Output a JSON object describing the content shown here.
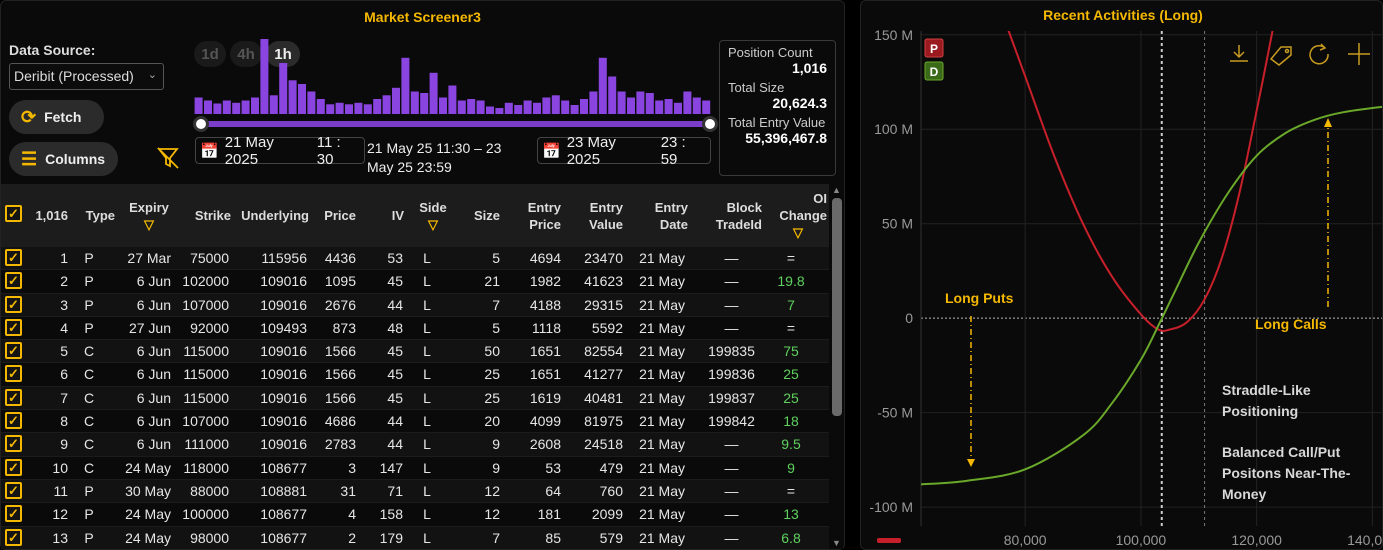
{
  "screener": {
    "title": "Market Screener3",
    "data_source_label": "Data Source:",
    "data_source_value": "Deribit (Processed)",
    "fetch_label": "Fetch",
    "columns_label": "Columns",
    "timeframes": [
      "1d",
      "4h",
      "1h"
    ],
    "active_timeframe": "1h",
    "start_date": "21 May 2025",
    "start_time": "11 : 30",
    "end_date": "23 May 2025",
    "end_time": "23 : 59",
    "range_line1": "21 May 25 11:30 – 23",
    "range_line2": "May 25 23:59",
    "histogram": [
      0.22,
      0.18,
      0.14,
      0.18,
      0.15,
      0.18,
      0.22,
      1.0,
      0.25,
      0.68,
      0.45,
      0.4,
      0.3,
      0.2,
      0.13,
      0.15,
      0.13,
      0.15,
      0.13,
      0.2,
      0.25,
      0.35,
      0.75,
      0.3,
      0.28,
      0.55,
      0.22,
      0.38,
      0.18,
      0.2,
      0.18,
      0.1,
      0.08,
      0.15,
      0.12,
      0.18,
      0.15,
      0.22,
      0.25,
      0.18,
      0.12,
      0.2,
      0.3,
      0.75,
      0.5,
      0.3,
      0.22,
      0.3,
      0.28,
      0.18,
      0.2,
      0.15,
      0.3,
      0.22,
      0.18
    ],
    "stats": {
      "position_count_label": "Position Count",
      "position_count": "1,016",
      "total_size_label": "Total Size",
      "total_size": "20,624.3",
      "total_entry_value_label": "Total Entry Value",
      "total_entry_value": "55,396,467.8"
    },
    "table": {
      "select_count": "1,016",
      "headers": {
        "type": "Type",
        "expiry": "Expiry",
        "strike": "Strike",
        "underlying": "Underlying",
        "price": "Price",
        "iv": "IV",
        "side": "Side",
        "size": "Size",
        "entry_price_1": "Entry",
        "entry_price_2": "Price",
        "entry_value_1": "Entry",
        "entry_value_2": "Value",
        "entry_date_1": "Entry",
        "entry_date_2": "Date",
        "block_1": "Block",
        "block_2": "TradeId",
        "oi_1": "OI",
        "oi_2": "Change"
      },
      "rows": [
        {
          "n": "1",
          "type": "P",
          "expiry": "27 Mar",
          "strike": "75000",
          "underlying": "115956",
          "price": "4436",
          "iv": "53",
          "side": "L",
          "size": "5",
          "entry_price": "4694",
          "entry_value": "23470",
          "entry_date": "21 May",
          "block": "—",
          "oi": "="
        },
        {
          "n": "2",
          "type": "P",
          "expiry": "6 Jun",
          "strike": "102000",
          "underlying": "109016",
          "price": "1095",
          "iv": "45",
          "side": "L",
          "size": "21",
          "entry_price": "1982",
          "entry_value": "41623",
          "entry_date": "21 May",
          "block": "—",
          "oi": "19.8"
        },
        {
          "n": "3",
          "type": "P",
          "expiry": "6 Jun",
          "strike": "107000",
          "underlying": "109016",
          "price": "2676",
          "iv": "44",
          "side": "L",
          "size": "7",
          "entry_price": "4188",
          "entry_value": "29315",
          "entry_date": "21 May",
          "block": "—",
          "oi": "7"
        },
        {
          "n": "4",
          "type": "P",
          "expiry": "27 Jun",
          "strike": "92000",
          "underlying": "109493",
          "price": "873",
          "iv": "48",
          "side": "L",
          "size": "5",
          "entry_price": "1118",
          "entry_value": "5592",
          "entry_date": "21 May",
          "block": "—",
          "oi": "="
        },
        {
          "n": "5",
          "type": "C",
          "expiry": "6 Jun",
          "strike": "115000",
          "underlying": "109016",
          "price": "1566",
          "iv": "45",
          "side": "L",
          "size": "50",
          "entry_price": "1651",
          "entry_value": "82554",
          "entry_date": "21 May",
          "block": "199835",
          "oi": "75"
        },
        {
          "n": "6",
          "type": "C",
          "expiry": "6 Jun",
          "strike": "115000",
          "underlying": "109016",
          "price": "1566",
          "iv": "45",
          "side": "L",
          "size": "25",
          "entry_price": "1651",
          "entry_value": "41277",
          "entry_date": "21 May",
          "block": "199836",
          "oi": "25"
        },
        {
          "n": "7",
          "type": "C",
          "expiry": "6 Jun",
          "strike": "115000",
          "underlying": "109016",
          "price": "1566",
          "iv": "45",
          "side": "L",
          "size": "25",
          "entry_price": "1619",
          "entry_value": "40481",
          "entry_date": "21 May",
          "block": "199837",
          "oi": "25"
        },
        {
          "n": "8",
          "type": "C",
          "expiry": "6 Jun",
          "strike": "107000",
          "underlying": "109016",
          "price": "4686",
          "iv": "44",
          "side": "L",
          "size": "20",
          "entry_price": "4099",
          "entry_value": "81975",
          "entry_date": "21 May",
          "block": "199842",
          "oi": "18"
        },
        {
          "n": "9",
          "type": "C",
          "expiry": "6 Jun",
          "strike": "111000",
          "underlying": "109016",
          "price": "2783",
          "iv": "44",
          "side": "L",
          "size": "9",
          "entry_price": "2608",
          "entry_value": "24518",
          "entry_date": "21 May",
          "block": "—",
          "oi": "9.5"
        },
        {
          "n": "10",
          "type": "C",
          "expiry": "24 May",
          "strike": "118000",
          "underlying": "108677",
          "price": "3",
          "iv": "147",
          "side": "L",
          "size": "9",
          "entry_price": "53",
          "entry_value": "479",
          "entry_date": "21 May",
          "block": "—",
          "oi": "9"
        },
        {
          "n": "11",
          "type": "P",
          "expiry": "30 May",
          "strike": "88000",
          "underlying": "108881",
          "price": "31",
          "iv": "71",
          "side": "L",
          "size": "12",
          "entry_price": "64",
          "entry_value": "760",
          "entry_date": "21 May",
          "block": "—",
          "oi": "="
        },
        {
          "n": "12",
          "type": "P",
          "expiry": "24 May",
          "strike": "100000",
          "underlying": "108677",
          "price": "4",
          "iv": "158",
          "side": "L",
          "size": "12",
          "entry_price": "181",
          "entry_value": "2099",
          "entry_date": "21 May",
          "block": "—",
          "oi": "13"
        },
        {
          "n": "13",
          "type": "P",
          "expiry": "24 May",
          "strike": "98000",
          "underlying": "108677",
          "price": "2",
          "iv": "179",
          "side": "L",
          "size": "7",
          "entry_price": "85",
          "entry_value": "579",
          "entry_date": "21 May",
          "block": "—",
          "oi": "6.8"
        }
      ]
    }
  },
  "activities": {
    "title": "Recent Activities (Long)",
    "legend_p": "P",
    "legend_d": "D",
    "annotations": {
      "long_puts": "Long Puts",
      "long_calls": "Long Calls",
      "straddle_1": "Straddle-Like",
      "straddle_2": "Positioning",
      "balanced_1": "Balanced Call/Put",
      "balanced_2": "Positons Near-The-",
      "balanced_3": "Money"
    },
    "colors": {
      "p_line": "#c8202a",
      "d_line": "#6aa82a",
      "accent": "#f5b800"
    }
  },
  "chart_data": {
    "type": "line",
    "title": "Recent Activities (Long)",
    "xlabel": "",
    "ylabel": "",
    "xlim": [
      62000,
      142000
    ],
    "ylim": [
      -110,
      152
    ],
    "x_ticks": [
      "80,000",
      "100,000",
      "120,000",
      "140,000"
    ],
    "x_tick_values": [
      80000,
      100000,
      120000,
      140000
    ],
    "y_ticks": [
      "150 M",
      "100 M",
      "50 M",
      "0",
      "-50 M",
      "-100 M"
    ],
    "y_tick_values": [
      150,
      100,
      50,
      0,
      -50,
      -100
    ],
    "grid": true,
    "legend": "top-left",
    "series": [
      {
        "name": "P",
        "x": [
          75000,
          80000,
          85000,
          90000,
          95000,
          100000,
          103000,
          105000,
          108000,
          111000,
          114000,
          117000,
          120000,
          123000,
          125000
        ],
        "y": [
          170,
          128,
          86,
          50,
          22,
          2,
          -6,
          -6,
          -2,
          10,
          32,
          66,
          110,
          156,
          190
        ]
      },
      {
        "name": "D",
        "x": [
          62000,
          70000,
          80000,
          90000,
          95000,
          100000,
          103000,
          106000,
          110000,
          115000,
          120000,
          125000,
          130000,
          135000,
          142000
        ],
        "y": [
          -88,
          -86,
          -80,
          -62,
          -45,
          -22,
          -4,
          15,
          40,
          66,
          86,
          98,
          105,
          109,
          112
        ]
      }
    ]
  }
}
